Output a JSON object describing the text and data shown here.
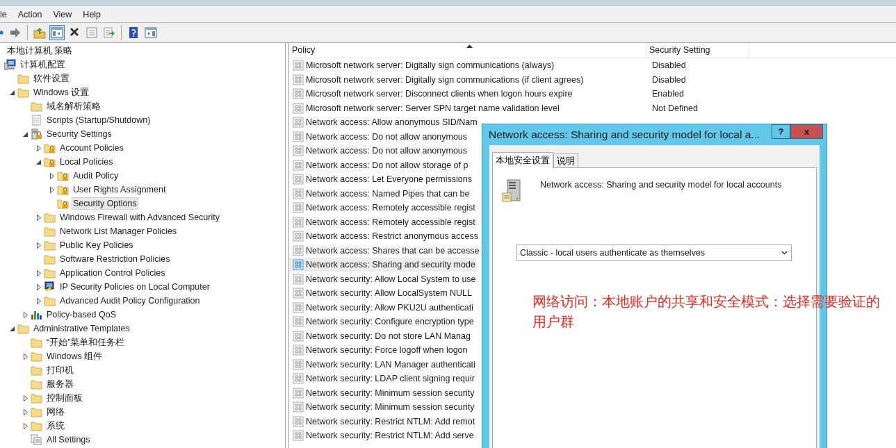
{
  "menu": [
    {
      "label": "le"
    },
    {
      "label": "Action"
    },
    {
      "label": "View"
    },
    {
      "label": "Help"
    }
  ],
  "toolbar": [
    {
      "kind": "back",
      "pressed": false
    },
    {
      "kind": "forward",
      "pressed": false
    },
    {
      "kind": "separator"
    },
    {
      "kind": "up",
      "pressed": false
    },
    {
      "kind": "tree-toggle",
      "pressed": true
    },
    {
      "kind": "delete",
      "pressed": false
    },
    {
      "kind": "properties",
      "pressed": false
    },
    {
      "kind": "export",
      "pressed": false
    },
    {
      "kind": "separator"
    },
    {
      "kind": "help",
      "pressed": false
    },
    {
      "kind": "pane-toggle",
      "pressed": false
    }
  ],
  "tree": {
    "label": "本地计算机 策略",
    "children": [
      {
        "label": "计算机配置",
        "kind": "computer",
        "selected": false,
        "children": [
          {
            "label": "软件设置",
            "kind": "folder",
            "selected": false
          },
          {
            "label": "Windows 设置",
            "kind": "folder",
            "selected": false,
            "expanded": true,
            "children": [
              {
                "label": "域名解析策略",
                "kind": "folder",
                "selected": false
              },
              {
                "label": "Scripts (Startup/Shutdown)",
                "kind": "script",
                "selected": false
              },
              {
                "label": "Security Settings",
                "kind": "security",
                "selected": false,
                "expanded": true,
                "children": [
                  {
                    "label": "Account Policies",
                    "kind": "locked-folder",
                    "selected": false,
                    "expanded": false
                  },
                  {
                    "label": "Local Policies",
                    "kind": "locked-folder",
                    "selected": false,
                    "expanded": true,
                    "children": [
                      {
                        "label": "Audit Policy",
                        "kind": "locked-folder",
                        "selected": false,
                        "expanded": false
                      },
                      {
                        "label": "User Rights Assignment",
                        "kind": "locked-folder",
                        "selected": false,
                        "expanded": false
                      },
                      {
                        "label": "Security Options",
                        "kind": "locked-folder",
                        "selected": true
                      }
                    ]
                  },
                  {
                    "label": "Windows Firewall with Advanced Security",
                    "kind": "folder",
                    "selected": false,
                    "expanded": false
                  },
                  {
                    "label": "Network List Manager Policies",
                    "kind": "folder",
                    "selected": false
                  },
                  {
                    "label": "Public Key Policies",
                    "kind": "folder",
                    "selected": false,
                    "expanded": false
                  },
                  {
                    "label": "Software Restriction Policies",
                    "kind": "folder",
                    "selected": false
                  },
                  {
                    "label": "Application Control Policies",
                    "kind": "folder",
                    "selected": false,
                    "expanded": false
                  },
                  {
                    "label": "IP Security Policies on Local Computer",
                    "kind": "ip",
                    "selected": false,
                    "expanded": false
                  },
                  {
                    "label": "Advanced Audit Policy Configuration",
                    "kind": "folder",
                    "selected": false,
                    "expanded": false
                  }
                ]
              },
              {
                "label": "Policy-based QoS",
                "kind": "qos",
                "selected": false,
                "expanded": false
              }
            ]
          },
          {
            "label": "Administrative Templates",
            "kind": "folder",
            "selected": false,
            "expanded": true,
            "children": [
              {
                "label": "“开始”菜单和任务栏",
                "kind": "folder",
                "selected": false
              },
              {
                "label": "Windows 组件",
                "kind": "folder",
                "selected": false,
                "expanded": false
              },
              {
                "label": "打印机",
                "kind": "folder",
                "selected": false
              },
              {
                "label": "服务器",
                "kind": "folder",
                "selected": false
              },
              {
                "label": "控制面板",
                "kind": "folder",
                "selected": false,
                "expanded": false
              },
              {
                "label": "网络",
                "kind": "folder",
                "selected": false,
                "expanded": false
              },
              {
                "label": "系统",
                "kind": "folder",
                "selected": false,
                "expanded": false
              },
              {
                "label": "All Settings",
                "kind": "settings",
                "selected": false
              }
            ]
          }
        ]
      }
    ]
  },
  "table": {
    "columns": [
      "Policy",
      "Security Setting"
    ],
    "rows": [
      {
        "policy": "Microsoft network server: Digitally sign communications (always)",
        "setting": "Disabled",
        "selected": false
      },
      {
        "policy": "Microsoft network server: Digitally sign communications (if client agrees)",
        "setting": "Disabled",
        "selected": false
      },
      {
        "policy": "Microsoft network server: Disconnect clients when logon hours expire",
        "setting": "Enabled",
        "selected": false
      },
      {
        "policy": "Microsoft network server: Server SPN target name validation level",
        "setting": "Not Defined",
        "selected": false
      },
      {
        "policy": "Network access: Allow anonymous SID/Nam",
        "selected": false
      },
      {
        "policy": "Network access: Do not allow anonymous",
        "selected": false
      },
      {
        "policy": "Network access: Do not allow anonymous",
        "selected": false
      },
      {
        "policy": "Network access: Do not allow storage of p",
        "selected": false
      },
      {
        "policy": "Network access: Let Everyone permissions",
        "selected": false
      },
      {
        "policy": "Network access: Named Pipes that can be",
        "selected": false
      },
      {
        "policy": "Network access: Remotely accessible regist",
        "selected": false
      },
      {
        "policy": "Network access: Remotely accessible regist",
        "selected": false
      },
      {
        "policy": "Network access: Restrict anonymous access",
        "selected": false
      },
      {
        "policy": "Network access: Shares that can be accesse",
        "selected": false
      },
      {
        "policy": "Network access: Sharing and security mode",
        "selected": true
      },
      {
        "policy": "Network security: Allow Local System to use",
        "selected": false
      },
      {
        "policy": "Network security: Allow LocalSystem NULL",
        "selected": false
      },
      {
        "policy": "Network security: Allow PKU2U authenticati",
        "selected": false
      },
      {
        "policy": "Network security: Configure encryption type",
        "selected": false
      },
      {
        "policy": "Network security: Do not store LAN Manag",
        "selected": false
      },
      {
        "policy": "Network security: Force logoff when logon",
        "selected": false
      },
      {
        "policy": "Network security: LAN Manager authenticati",
        "selected": false
      },
      {
        "policy": "Network security: LDAP client signing requir",
        "selected": false
      },
      {
        "policy": "Network security: Minimum session security",
        "selected": false
      },
      {
        "policy": "Network security: Minimum session security",
        "selected": false
      },
      {
        "policy": "Network security: Restrict NTLM: Add remot",
        "selected": false
      },
      {
        "policy": "Network security: Restrict NTLM: Add serve",
        "selected": false
      }
    ]
  },
  "dialog": {
    "title": "Network access: Sharing and security model for local a...",
    "help": "?",
    "close": "x",
    "tabs": [
      {
        "label": "本地安全设置",
        "selected": true
      },
      {
        "label": "说明",
        "selected": false
      }
    ],
    "description": "Network access: Sharing and security model for local accounts",
    "select": {
      "value": "Classic - local users authenticate as themselves"
    }
  },
  "annotation": "网络访问：本地账户的共享和安全模式：选择需要验证的用户群"
}
